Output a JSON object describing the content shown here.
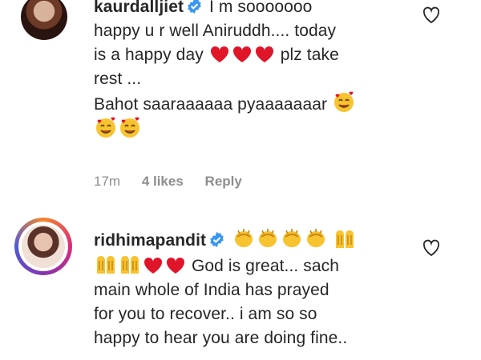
{
  "comments": [
    {
      "username": "kaurdalljiet",
      "text_line1": "I m sooooooo",
      "text_line2": "happy u r well Aniruddh.... today",
      "text_line3a": "is a happy day",
      "text_line3b": "plz take",
      "text_line4": "rest ...",
      "text_line5": "Bahot saaraaaaaa pyaaaaaaar",
      "emoji_hearts": "red-heart",
      "emoji_smiling": "smiling-face-with-hearts",
      "time": "17m",
      "likes": "4 likes",
      "reply_label": "Reply"
    },
    {
      "username": "ridhimapandit",
      "emoji_clap": "clapping-hands",
      "emoji_praise": "raising-hands",
      "text_line2": "God is great... sach",
      "text_line3": "main whole of India has prayed",
      "text_line4": "for you to recover.. i am so so",
      "text_line5": "happy to hear you are doing fine.."
    }
  ],
  "colors": {
    "text": "#262626",
    "meta": "#8e8e8e",
    "verified": "#3897f0",
    "heart": "#e0152a",
    "emoji_yellow": "#f7c32e"
  }
}
